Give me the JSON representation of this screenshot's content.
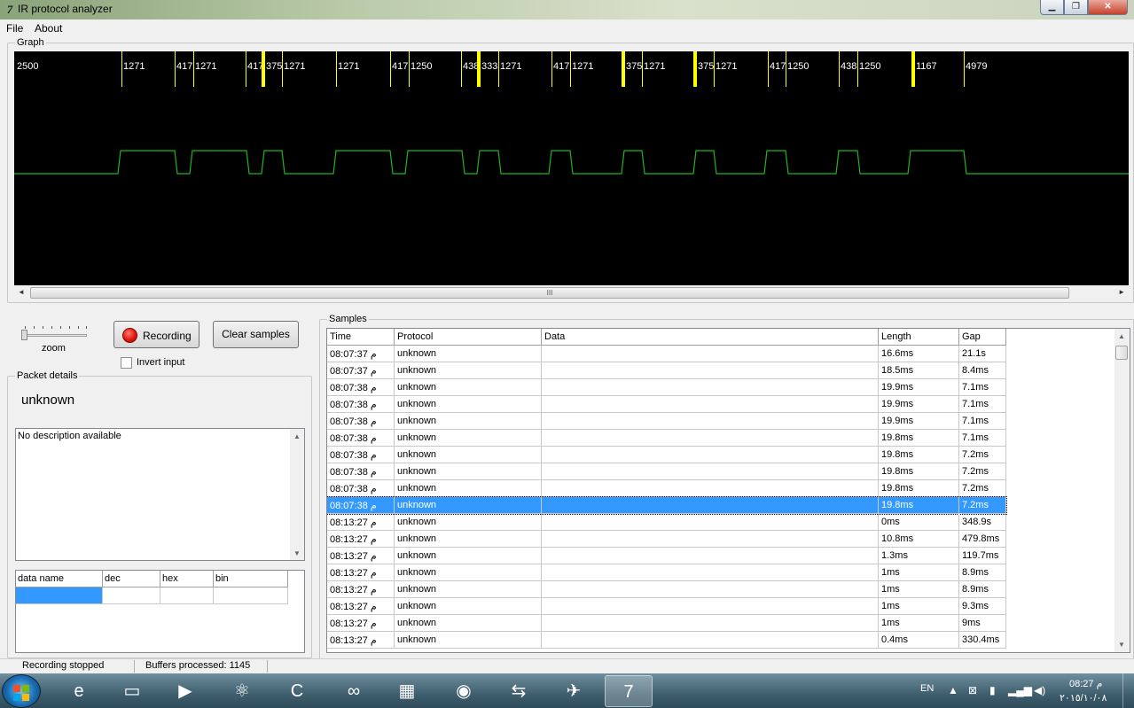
{
  "window": {
    "title": "IR protocol analyzer",
    "icon": "7-app-icon"
  },
  "menu": {
    "file": "File",
    "about": "About"
  },
  "graph": {
    "legend": "Graph",
    "labels": [
      "2500",
      "1271",
      "417",
      "1271",
      "417",
      "375",
      "1271",
      "1271",
      "417",
      "1250",
      "438",
      "333",
      "1271",
      "417",
      "1271",
      "375",
      "1271",
      "375",
      "1271",
      "417",
      "1250",
      "438",
      "1250",
      "1167",
      "4979"
    ],
    "signal_color": "#1fb51f",
    "marker_color": "#ffff00",
    "scroll_grip": "III"
  },
  "controls": {
    "zoom_label": "zoom",
    "recording_label": "Recording",
    "clear_label": "Clear samples",
    "invert_label": "Invert input",
    "invert_checked": false
  },
  "packet": {
    "legend": "Packet details",
    "name": "unknown",
    "description": "No description available",
    "columns": [
      "data name",
      "dec",
      "hex",
      "bin"
    ]
  },
  "samples": {
    "legend": "Samples",
    "columns": [
      "Time",
      "Protocol",
      "Data",
      "Length",
      "Gap"
    ],
    "rows": [
      {
        "time": "08:07:37 م",
        "protocol": "unknown",
        "data": "",
        "length": "16.6ms",
        "gap": "21.1s"
      },
      {
        "time": "08:07:37 م",
        "protocol": "unknown",
        "data": "",
        "length": "18.5ms",
        "gap": "8.4ms"
      },
      {
        "time": "08:07:38 م",
        "protocol": "unknown",
        "data": "",
        "length": "19.9ms",
        "gap": "7.1ms"
      },
      {
        "time": "08:07:38 م",
        "protocol": "unknown",
        "data": "",
        "length": "19.9ms",
        "gap": "7.1ms"
      },
      {
        "time": "08:07:38 م",
        "protocol": "unknown",
        "data": "",
        "length": "19.9ms",
        "gap": "7.1ms"
      },
      {
        "time": "08:07:38 م",
        "protocol": "unknown",
        "data": "",
        "length": "19.8ms",
        "gap": "7.1ms"
      },
      {
        "time": "08:07:38 م",
        "protocol": "unknown",
        "data": "",
        "length": "19.8ms",
        "gap": "7.2ms"
      },
      {
        "time": "08:07:38 م",
        "protocol": "unknown",
        "data": "",
        "length": "19.8ms",
        "gap": "7.2ms"
      },
      {
        "time": "08:07:38 م",
        "protocol": "unknown",
        "data": "",
        "length": "19.8ms",
        "gap": "7.2ms"
      },
      {
        "time": "08:07:38 م",
        "protocol": "unknown",
        "data": "",
        "length": "19.8ms",
        "gap": "7.2ms",
        "selected": true
      },
      {
        "time": "08:13:27 م",
        "protocol": "unknown",
        "data": "",
        "length": "0ms",
        "gap": "348.9s"
      },
      {
        "time": "08:13:27 م",
        "protocol": "unknown",
        "data": "",
        "length": "10.8ms",
        "gap": "479.8ms"
      },
      {
        "time": "08:13:27 م",
        "protocol": "unknown",
        "data": "",
        "length": "1.3ms",
        "gap": "119.7ms"
      },
      {
        "time": "08:13:27 م",
        "protocol": "unknown",
        "data": "",
        "length": "1ms",
        "gap": "8.9ms"
      },
      {
        "time": "08:13:27 م",
        "protocol": "unknown",
        "data": "",
        "length": "1ms",
        "gap": "8.9ms"
      },
      {
        "time": "08:13:27 م",
        "protocol": "unknown",
        "data": "",
        "length": "1ms",
        "gap": "9.3ms"
      },
      {
        "time": "08:13:27 م",
        "protocol": "unknown",
        "data": "",
        "length": "1ms",
        "gap": "9ms"
      },
      {
        "time": "08:13:27 م",
        "protocol": "unknown",
        "data": "",
        "length": "0.4ms",
        "gap": "330.4ms"
      }
    ]
  },
  "status": {
    "state": "Recording stopped",
    "buffers": "Buffers processed: 1145"
  },
  "taskbar": {
    "apps": [
      "ie-icon",
      "explorer-icon",
      "media-player-icon",
      "atom-icon",
      "ccleaner-icon",
      "arduino-icon",
      "pcb-icon",
      "chrome-icon",
      "switch-icon",
      "satellite-icon",
      "ir-analyzer-icon"
    ],
    "lang": "EN",
    "time": "08:27 م",
    "date": "٢٠١٥/١٠/٠٨"
  }
}
